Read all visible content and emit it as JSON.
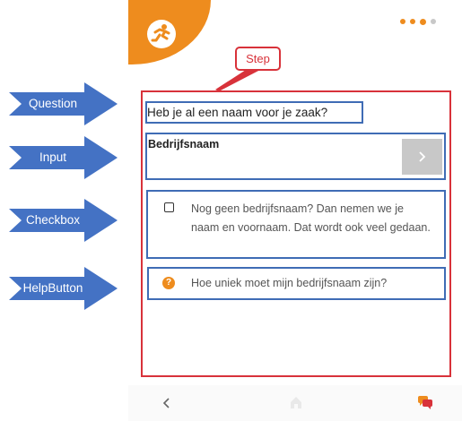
{
  "annotations": {
    "step_label": "Step",
    "arrows": [
      {
        "label": "Question"
      },
      {
        "label": "Input"
      },
      {
        "label": "Checkbox"
      },
      {
        "label": "HelpButton"
      }
    ],
    "arrow_color": "#4472c4",
    "frame_color": "#d8323a",
    "box_color": "#3f6cb5"
  },
  "app": {
    "brand_color": "#ee8c1e",
    "logo_icon": "running-figure-icon",
    "progress_dots": {
      "total": 4,
      "current": 3
    }
  },
  "step": {
    "question": "Heb je al een naam voor je zaak?",
    "input": {
      "value": "Bedrijfsnaam",
      "next_icon": "chevron-right-icon"
    },
    "checkbox": {
      "checked": false,
      "label": "Nog geen bedrijfsnaam? Dan nemen we je naam en voornaam. Dat wordt ook veel gedaan."
    },
    "help": {
      "icon": "question-icon",
      "label": "Hoe uniek moet mijn bedrijfsnaam zijn?"
    }
  },
  "nav": {
    "back_icon": "chevron-left-icon",
    "home_icon": "home-icon",
    "chat_icon": "chat-icon"
  }
}
